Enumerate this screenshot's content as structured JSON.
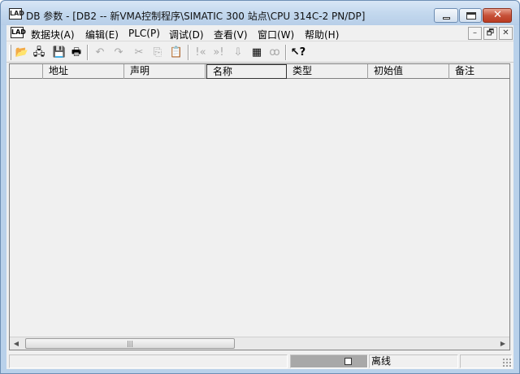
{
  "window": {
    "title": "DB 参数 - [DB2 -- 新VMA控制程序\\SIMATIC 300 站点\\CPU 314C-2 PN/DP]",
    "app_icon_text": "LAD",
    "controls": {
      "close_glyph": "✕"
    }
  },
  "menubar": {
    "items": [
      "数据块(A)",
      "编辑(E)",
      "PLC(P)",
      "调试(D)",
      "查看(V)",
      "窗口(W)",
      "帮助(H)"
    ],
    "mdi_controls": [
      "–",
      "🗗",
      "✕"
    ]
  },
  "toolbar": {
    "buttons": [
      {
        "icon": "open-folder-icon",
        "glyph": "📂",
        "enabled": true
      },
      {
        "icon": "network-access-icon",
        "glyph": "🖧",
        "enabled": true
      },
      {
        "icon": "save-icon",
        "glyph": "💾",
        "enabled": true
      },
      {
        "icon": "print-icon",
        "glyph": "🖶",
        "enabled": true
      },
      {
        "icon": "undo-icon",
        "glyph": "↶",
        "enabled": false
      },
      {
        "icon": "redo-icon",
        "glyph": "↷",
        "enabled": false
      },
      {
        "icon": "cut-icon",
        "glyph": "✂",
        "enabled": false
      },
      {
        "icon": "copy-icon",
        "glyph": "⎘",
        "enabled": false
      },
      {
        "icon": "paste-icon",
        "glyph": "📋",
        "enabled": false
      },
      {
        "icon": "previous-icon",
        "glyph": "!«",
        "enabled": false
      },
      {
        "icon": "next-icon",
        "glyph": "»!",
        "enabled": false
      },
      {
        "icon": "download-icon",
        "glyph": "⇩",
        "enabled": false
      },
      {
        "icon": "monitor-icon",
        "glyph": "▦",
        "enabled": true
      },
      {
        "icon": "glasses-icon",
        "glyph": "ꝏ",
        "enabled": false
      },
      {
        "icon": "help-pointer-icon",
        "glyph": "↖?",
        "enabled": true
      }
    ]
  },
  "table": {
    "columns": [
      "",
      "地址",
      "声明",
      "名称",
      "类型",
      "初始值",
      "备注"
    ],
    "active_column": "名称",
    "rows": []
  },
  "scrollbar": {
    "thumb_glyph": "|||"
  },
  "statusbar": {
    "connection": "离线"
  }
}
